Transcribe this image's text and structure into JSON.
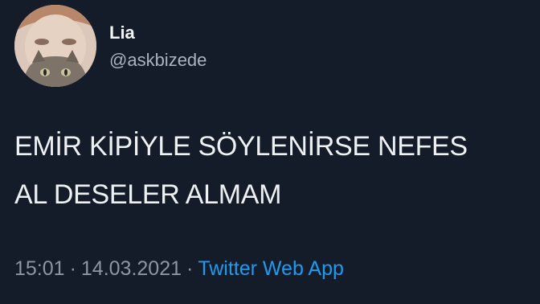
{
  "tweet": {
    "author": {
      "display_name": "Lia",
      "handle": "@askbizede"
    },
    "text_lines": [
      "EMİR KİPİYLE SÖYLENİRSE NEFES",
      "AL DESELER ALMAM"
    ],
    "time": "15:01",
    "separator": "·",
    "date": "14.03.2021",
    "source": "Twitter Web App"
  },
  "colors": {
    "background": "#151c29",
    "source_link": "#1d9bf0"
  }
}
